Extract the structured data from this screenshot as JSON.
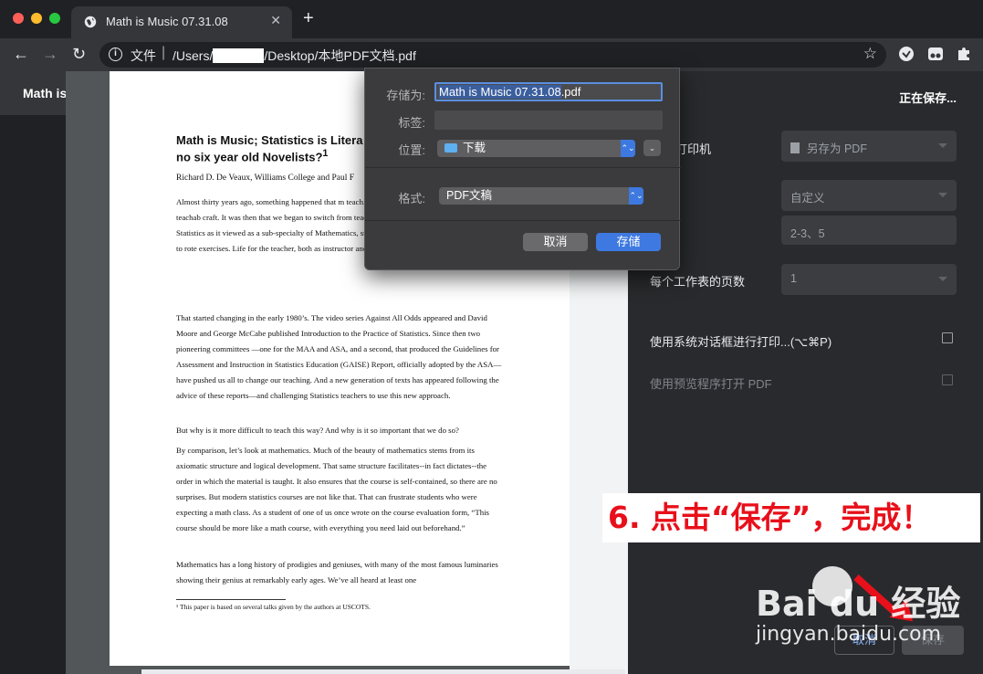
{
  "browser": {
    "tab_title": "Math is Music 07.31.08",
    "tab_close": "✕",
    "new_tab": "+",
    "back": "←",
    "forward": "→",
    "reload": "↻",
    "omnibox": {
      "scheme_label": "文件",
      "separator": "|",
      "url_prefix": "/Users/",
      "url_suffix": "/Desktop/本地PDF文档.pdf"
    },
    "bookmark_icon": "☆"
  },
  "page_header": {
    "title": "Math is"
  },
  "document": {
    "title_line1": "Math is Music; Statistics is Litera",
    "title_line2": "no six year old Novelists?",
    "title_sup": "1",
    "authors": "Richard D. De Veaux, Williams College and Paul F",
    "paragraphs": [
      "Almost thirty years ago, something happened that m teach. Students didn't suddenly become less teachab craft. It was then that we began to switch from teach course to teaching the art and craft of Statistics as it viewed as a sub-specialty of Mathematics, students and calculate the “correct” answer to rote exercises. Life for the teacher, both as instructor and grader was easy.",
      "That started changing in the early 1980’s. The video series Against All Odds appeared and David Moore and George McCabe published Introduction to the Practice of Statistics. Since then two pioneering committees —one for the MAA and ASA, and a second, that produced the Guidelines for Assessment and Instruction in Statistics Education (GAISE) Report, officially adopted by the ASA—have pushed us all to change our teaching. And a new generation of texts has appeared following the advice of these reports—and challenging Statistics teachers to use this new approach.",
      "But why is it more difficult to teach this way? And why is it so important that we do so?",
      "By comparison, let’s look at mathematics. Much of the beauty of mathematics stems from its axiomatic structure and logical development. That same structure facilitates--in fact dictates--the order in which the material is taught. It also ensures that the course is self-contained, so there are no surprises. But modern statistics courses are not like that. That can frustrate students who were expecting a math class. As a student of one of us once wrote on the course evaluation form, “This course should be more like a math course, with everything you need laid out beforehand.”",
      "Mathematics has a long history of prodigies and geniuses, with many of the most famous luminaries showing their genius at remarkably early ages. We’ve all heard at least one"
    ],
    "footnote": "¹ This paper is based on several talks given by the authors at USCOTS."
  },
  "print_panel": {
    "status": "正在保存...",
    "destination_label": "打印机",
    "destination_value": "另存为 PDF",
    "pages_value": "自定义",
    "pages_input": "2-3、5",
    "pages_per_sheet_label": "每个工作表的页数",
    "pages_per_sheet_value": "1",
    "system_dialog_link": "使用系统对话框进行打印...(⌥⌘P)",
    "preview_link": "使用预览程序打开 PDF",
    "cancel_label": "取消",
    "save_label": "保存"
  },
  "save_dialog": {
    "save_as_label": "存储为:",
    "filename_selected": "Math is Music 07.31.08",
    "filename_ext": ".pdf",
    "tags_label": "标签:",
    "where_label": "位置:",
    "where_value": "下载",
    "format_label": "格式:",
    "format_value": "PDF文稿",
    "cancel_label": "取消",
    "save_label": "存储",
    "popup_arrows": "⌃⌄",
    "expand_arrow": "⌄"
  },
  "annotation": {
    "text": "6. 点击“保存”，完成！",
    "color": "#e8101a"
  },
  "watermark": {
    "brand": "Bai du 经验",
    "url": "jingyan.baidu.com"
  },
  "colors": {
    "accent_blue": "#3d79e0",
    "link_blue": "#8ab4f8",
    "panel_bg": "#292a2d"
  }
}
